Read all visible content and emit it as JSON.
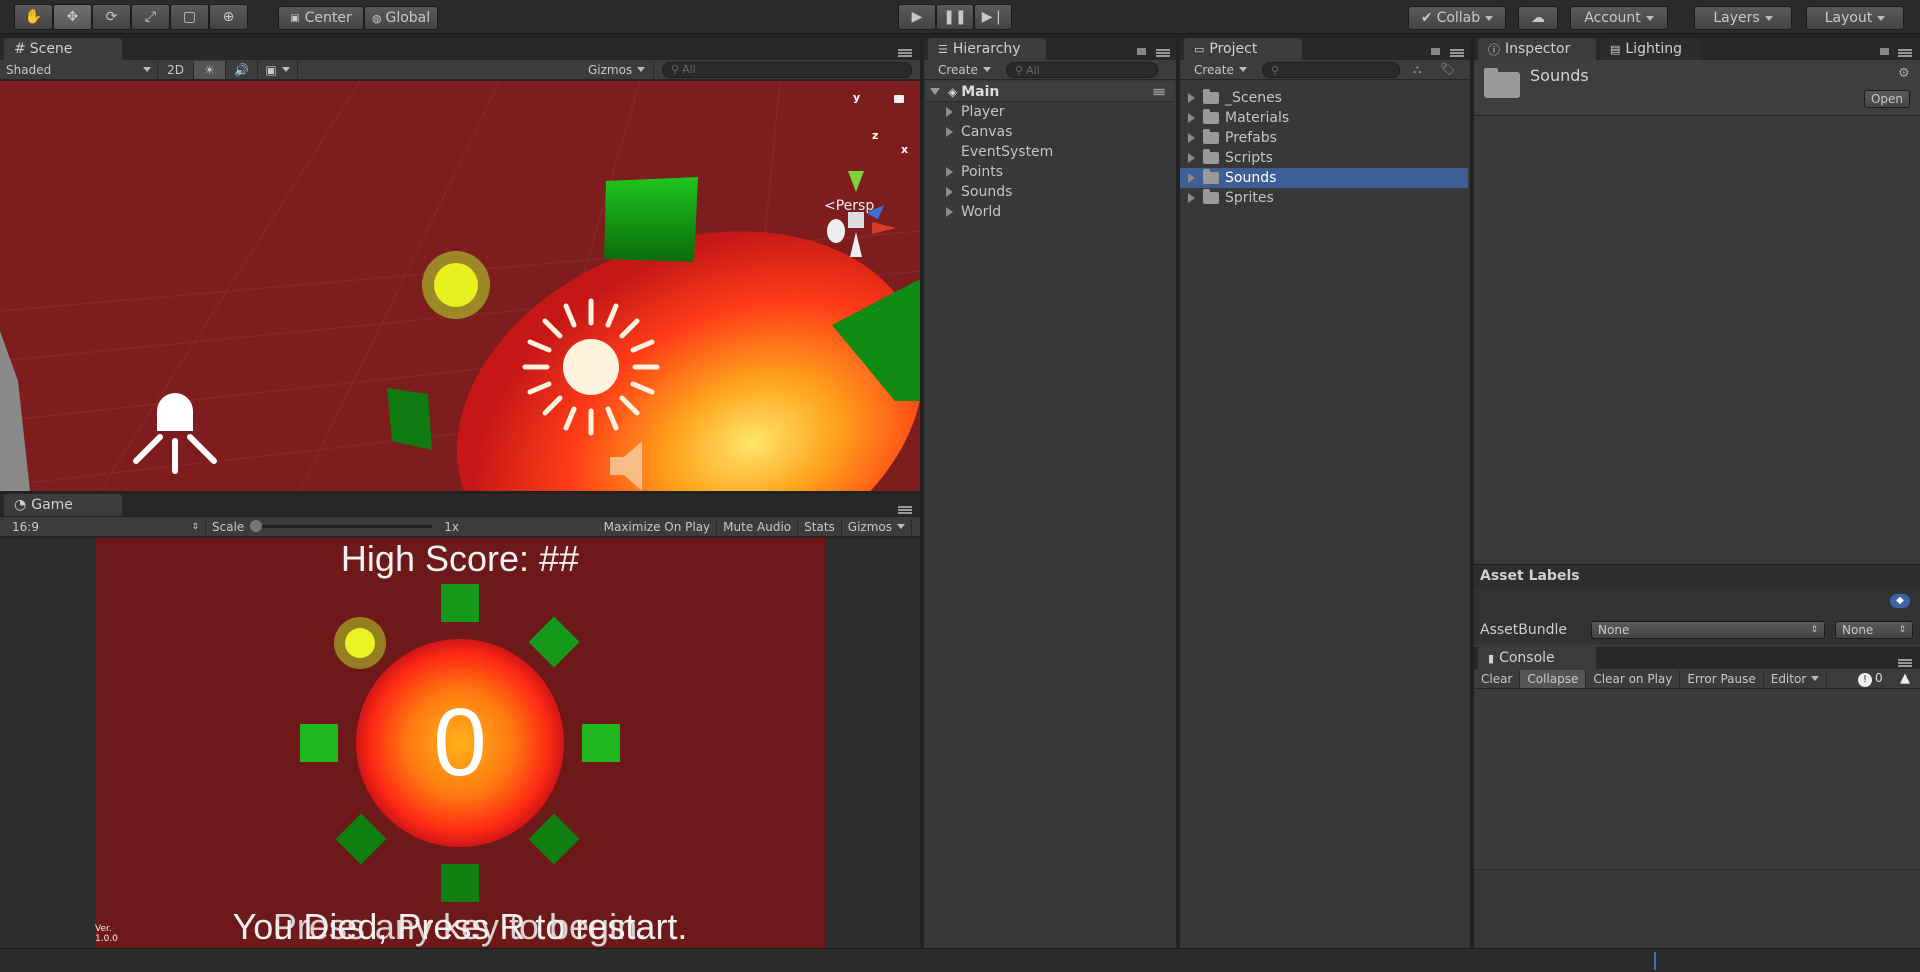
{
  "toolbar": {
    "tools": [
      "hand",
      "move",
      "rotate",
      "scale",
      "rect",
      "transform"
    ],
    "center_label": "Center",
    "global_label": "Global",
    "collab_label": "Collab",
    "account_label": "Account",
    "layers_label": "Layers",
    "layout_label": "Layout"
  },
  "scene": {
    "tab": "Scene",
    "shading": "Shaded",
    "mode_2d": "2D",
    "gizmos": "Gizmos",
    "search_placeholder": "All",
    "persp_label": "Persp",
    "axis_y": "y",
    "axis_z": "z",
    "axis_x": "x"
  },
  "game": {
    "tab": "Game",
    "aspect": "16:9",
    "scale_label": "Scale",
    "scale_value": "1x",
    "maximize": "Maximize On Play",
    "mute": "Mute Audio",
    "stats": "Stats",
    "gizmos": "Gizmos",
    "high_score": "High Score: ##",
    "center_number": "0",
    "bottom_text_a": "You Died, Press R to restart.",
    "bottom_text_b": "Press any key to begin.",
    "version_label": "Ver.",
    "version": "1.0.0"
  },
  "hierarchy": {
    "tab": "Hierarchy",
    "create": "Create",
    "search_placeholder": "All",
    "scene_name": "Main",
    "items": [
      {
        "label": "Player",
        "expandable": true
      },
      {
        "label": "Canvas",
        "expandable": true
      },
      {
        "label": "EventSystem",
        "expandable": false
      },
      {
        "label": "Points",
        "expandable": true
      },
      {
        "label": "Sounds",
        "expandable": true
      },
      {
        "label": "World",
        "expandable": true
      }
    ]
  },
  "project": {
    "tab": "Project",
    "create": "Create",
    "folders": [
      "_Scenes",
      "Materials",
      "Prefabs",
      "Scripts",
      "Sounds",
      "Sprites"
    ],
    "selected": "Sounds"
  },
  "inspector": {
    "tab": "Inspector",
    "tab2": "Lighting",
    "asset_name": "Sounds",
    "open_label": "Open",
    "asset_labels": "Asset Labels",
    "assetbundle_label": "AssetBundle",
    "assetbundle_value": "None",
    "variant_value": "None"
  },
  "console": {
    "tab": "Console",
    "buttons": [
      "Clear",
      "Collapse",
      "Clear on Play",
      "Error Pause",
      "Editor"
    ],
    "error_count": "0"
  },
  "colors": {
    "selection": "#3e5f96",
    "scene_bg": "#7d1d1d",
    "game_bg": "#6e1919",
    "green_block": "#1a9a1a"
  }
}
